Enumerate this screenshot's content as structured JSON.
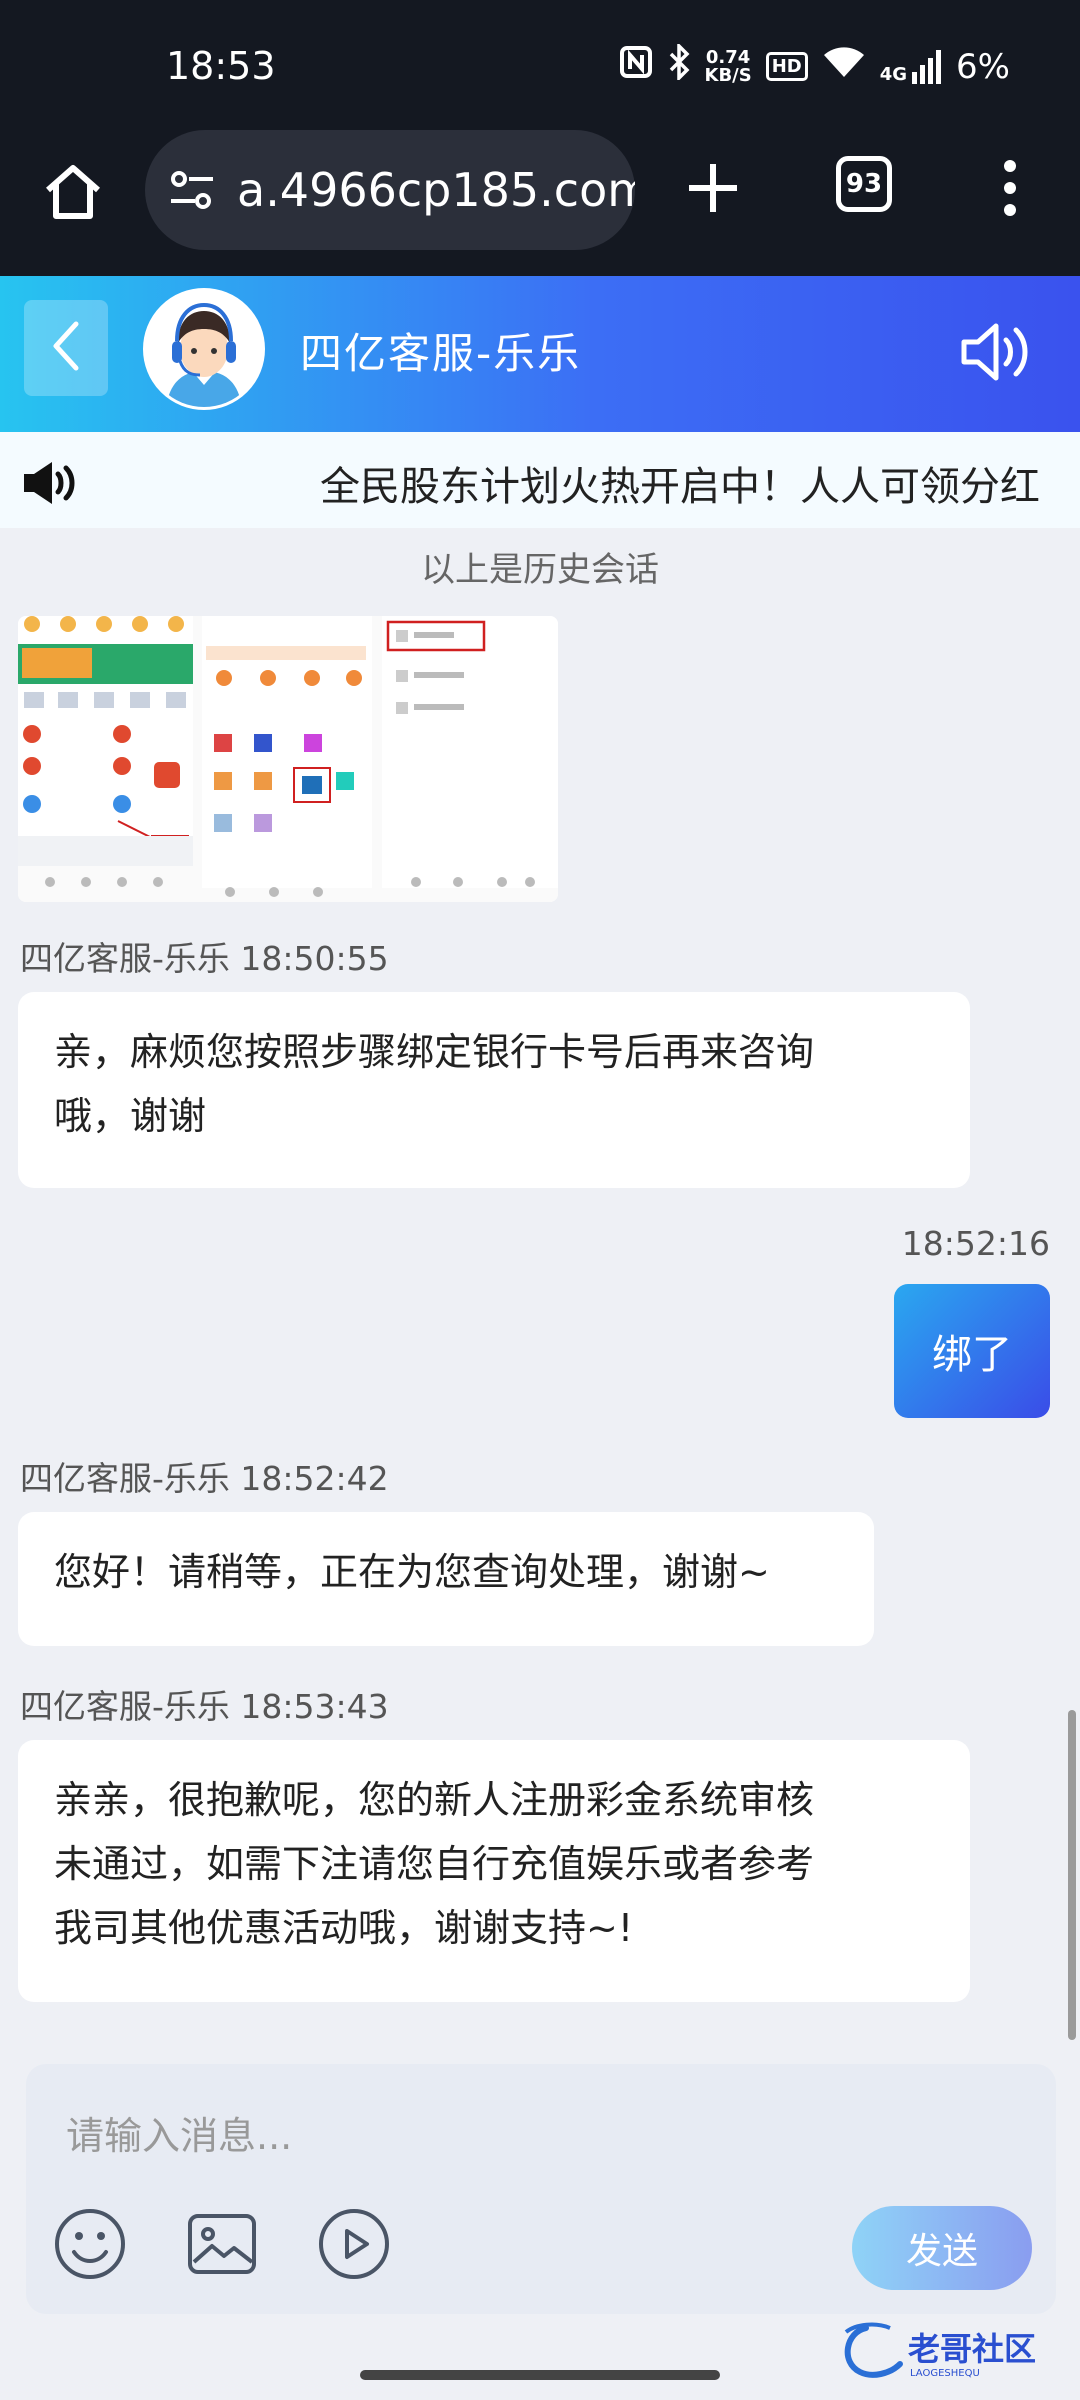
{
  "status_bar": {
    "time": "18:53",
    "net_speed_top": "0.74",
    "net_speed_bottom": "KB/S",
    "hd_label": "HD",
    "network": "4G",
    "battery": "6%"
  },
  "browser": {
    "url": "a.4966cp185.com",
    "tab_count": "93"
  },
  "chat_header": {
    "agent_name": "四亿客服-乐乐"
  },
  "marquee": {
    "text": "全民股东计划火热开启中！人人可领分红"
  },
  "messages": {
    "history_note": "以上是历史会话",
    "m1": {
      "sender": "四亿客服-乐乐 18:50:55",
      "text_line1": "亲，麻烦您按照步骤绑定银行卡号后再来咨询",
      "text_line2": "哦，谢谢"
    },
    "m2": {
      "time": "18:52:16",
      "text": "绑了"
    },
    "m3": {
      "sender": "四亿客服-乐乐 18:52:42",
      "text": "您好！请稍等，正在为您查询处理，谢谢~"
    },
    "m4": {
      "sender": "四亿客服-乐乐 18:53:43",
      "text_line1": "亲亲，很抱歉呢，您的新人注册彩金系统审核",
      "text_line2": "未通过，如需下注请您自行充值娱乐或者参考",
      "text_line3": "我司其他优惠活动哦，谢谢支持~!"
    }
  },
  "input": {
    "placeholder": "请输入消息...",
    "send_label": "发送"
  },
  "icons": {
    "home": "home-icon",
    "site_settings": "tune-icon",
    "new_tab": "plus-icon",
    "menu": "more-vert-icon",
    "back": "chevron-left-icon",
    "speaker": "speaker-icon",
    "horn": "megaphone-icon",
    "emoji": "emoji-icon",
    "image": "image-icon",
    "video": "video-play-icon"
  },
  "colors": {
    "header_gradient_start": "#27c4f0",
    "header_gradient_end": "#3a52ee",
    "chrome_bg": "#141821",
    "chat_bg": "#eef0f5"
  }
}
